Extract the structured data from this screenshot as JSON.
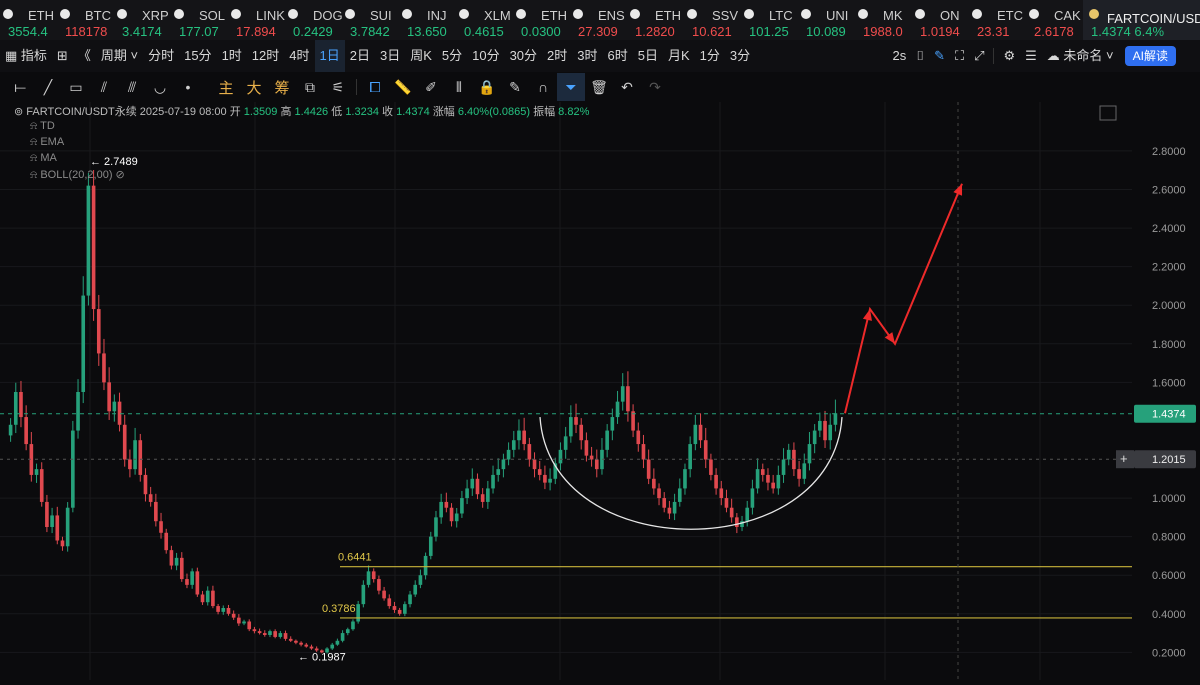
{
  "tickers": [
    {
      "sym": "ETH",
      "price": "3554.4",
      "color": "#26c281"
    },
    {
      "sym": "BTC",
      "price": "118178",
      "color": "#f04d4d"
    },
    {
      "sym": "XRP",
      "price": "3.4174",
      "color": "#26c281"
    },
    {
      "sym": "SOL",
      "price": "177.07",
      "color": "#26c281"
    },
    {
      "sym": "LINK",
      "price": "17.894",
      "color": "#f04d4d"
    },
    {
      "sym": "DOGE",
      "price": "0.2429",
      "color": "#26c281"
    },
    {
      "sym": "SUI",
      "price": "3.7842",
      "color": "#26c281"
    },
    {
      "sym": "INJ",
      "price": "13.650",
      "color": "#26c281"
    },
    {
      "sym": "XLM",
      "price": "0.4615",
      "color": "#26c281"
    },
    {
      "sym": "ETH",
      "price": "0.0300",
      "color": "#26c281"
    },
    {
      "sym": "ENS",
      "price": "27.309",
      "color": "#f04d4d"
    },
    {
      "sym": "ETH",
      "price": "1.2820",
      "color": "#f04d4d"
    },
    {
      "sym": "SSV",
      "price": "10.621",
      "color": "#f04d4d"
    },
    {
      "sym": "LTC",
      "price": "101.25",
      "color": "#26c281"
    },
    {
      "sym": "UNI",
      "price": "10.089",
      "color": "#26c281"
    },
    {
      "sym": "MK",
      "price": "1988.0",
      "color": "#f04d4d"
    },
    {
      "sym": "ON",
      "price": "1.0194",
      "color": "#f04d4d"
    },
    {
      "sym": "ETC",
      "price": "23.31",
      "color": "#f04d4d"
    },
    {
      "sym": "CAK",
      "price": "2.6178",
      "color": "#f04d4d"
    }
  ],
  "active_ticker": {
    "sym": "FARTCOIN/USDT永",
    "price": "1.4374",
    "change": "6.4%",
    "color": "#26c281"
  },
  "toolbar": {
    "indicator": "指标",
    "period": "周期",
    "intervals": [
      "分时",
      "15分",
      "1时",
      "12时",
      "4时",
      "1日",
      "2日",
      "3日",
      "周K",
      "5分",
      "10分",
      "30分",
      "2时",
      "3时",
      "6时",
      "5日",
      "月K",
      "1分",
      "3分"
    ],
    "active_interval": "1日",
    "refresh": "2s",
    "layout_name": "未命名",
    "ai_label": "AI解读"
  },
  "drawtools": {
    "main": "主",
    "big": "大",
    "chip": "筹"
  },
  "info": {
    "symbol": "FARTCOIN/USDT永续",
    "date": "2025-07-19 08:00",
    "open_label": "开",
    "open": "1.3509",
    "high_label": "高",
    "high": "1.4426",
    "low_label": "低",
    "low": "1.3234",
    "close_label": "收",
    "close": "1.4374",
    "chg_label": "涨幅",
    "chg": "6.40%(0.0865)",
    "amp_label": "振幅",
    "amp": "8.82%"
  },
  "indicators": [
    "TD",
    "EMA",
    "MA",
    "BOLL(20,2,00)"
  ],
  "chart_data": {
    "type": "candlestick",
    "y_ticks": [
      "2.8000",
      "2.6000",
      "2.4000",
      "2.2000",
      "2.0000",
      "1.8000",
      "1.6000",
      "1.4374",
      "1.2015",
      "1.0000",
      "0.8000",
      "0.6000",
      "0.4000",
      "0.2000"
    ],
    "ylim": [
      0.15,
      2.95
    ],
    "current_price": "1.4374",
    "crosshair_price": "1.2015",
    "high_marker": "2.7489",
    "low_marker": "0.1987",
    "levels": [
      {
        "label": "0.6441",
        "value": 0.6441
      },
      {
        "label": "0.3786",
        "value": 0.3786
      }
    ],
    "projection": [
      1.44,
      1.98,
      1.8,
      2.63
    ],
    "series_close": [
      1.38,
      1.55,
      1.42,
      1.28,
      1.12,
      1.15,
      0.98,
      0.85,
      0.91,
      0.78,
      0.75,
      0.95,
      1.35,
      1.55,
      2.05,
      2.62,
      1.98,
      1.75,
      1.6,
      1.45,
      1.5,
      1.38,
      1.2,
      1.15,
      1.3,
      1.12,
      1.02,
      0.98,
      0.88,
      0.82,
      0.73,
      0.65,
      0.69,
      0.58,
      0.55,
      0.62,
      0.5,
      0.46,
      0.52,
      0.44,
      0.41,
      0.43,
      0.4,
      0.38,
      0.35,
      0.36,
      0.32,
      0.31,
      0.3,
      0.29,
      0.31,
      0.28,
      0.3,
      0.27,
      0.26,
      0.25,
      0.24,
      0.23,
      0.22,
      0.21,
      0.2,
      0.22,
      0.24,
      0.26,
      0.3,
      0.32,
      0.36,
      0.45,
      0.55,
      0.62,
      0.58,
      0.52,
      0.48,
      0.44,
      0.42,
      0.4,
      0.45,
      0.5,
      0.55,
      0.6,
      0.7,
      0.8,
      0.9,
      0.98,
      0.95,
      0.88,
      0.92,
      1.0,
      1.05,
      1.1,
      1.02,
      0.98,
      1.05,
      1.12,
      1.15,
      1.2,
      1.25,
      1.3,
      1.35,
      1.28,
      1.2,
      1.15,
      1.12,
      1.08,
      1.1,
      1.18,
      1.25,
      1.32,
      1.42,
      1.38,
      1.3,
      1.22,
      1.2,
      1.15,
      1.25,
      1.35,
      1.42,
      1.5,
      1.58,
      1.45,
      1.35,
      1.28,
      1.2,
      1.1,
      1.05,
      1.0,
      0.95,
      0.92,
      0.98,
      1.05,
      1.15,
      1.28,
      1.38,
      1.3,
      1.2,
      1.12,
      1.05,
      1.0,
      0.95,
      0.9,
      0.85,
      0.88,
      0.95,
      1.05,
      1.15,
      1.12,
      1.08,
      1.05,
      1.12,
      1.2,
      1.25,
      1.15,
      1.1,
      1.18,
      1.28,
      1.35,
      1.4,
      1.3,
      1.38,
      1.44
    ]
  }
}
